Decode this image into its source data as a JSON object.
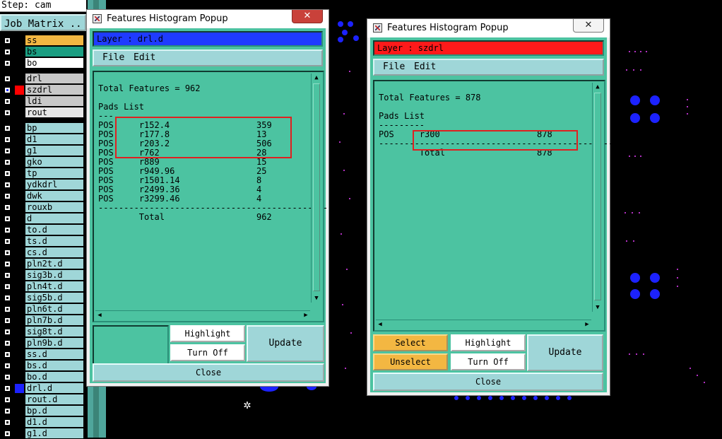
{
  "app": {
    "step_label": "Step: cam",
    "job_matrix_label": "Job Matrix ..",
    "layers": [
      {
        "name": "ss",
        "color": "#f3b742",
        "swatch": "#000"
      },
      {
        "name": "bs",
        "color": "#1b9e82",
        "swatch": "#000"
      },
      {
        "name": "bo",
        "color": "#ffffff",
        "swatch": "#000"
      },
      {
        "name": "drl",
        "color": "#c8c8c8",
        "swatch": "#000"
      },
      {
        "name": "szdrl",
        "color": "#c8c8c8",
        "swatch": "#ff0000",
        "selected": true
      },
      {
        "name": "ldi",
        "color": "#c8c8c8",
        "swatch": "#000"
      },
      {
        "name": "rout",
        "color": "#e6e6e6",
        "swatch": "#000"
      },
      {
        "name": "bp",
        "swatch": "#000"
      },
      {
        "name": "d1",
        "swatch": "#000"
      },
      {
        "name": "g1",
        "swatch": "#000"
      },
      {
        "name": "gko",
        "swatch": "#000"
      },
      {
        "name": "tp",
        "swatch": "#000"
      },
      {
        "name": "ydkdrl",
        "swatch": "#000"
      },
      {
        "name": "dwk",
        "swatch": "#000"
      },
      {
        "name": "rouxb",
        "swatch": "#000"
      },
      {
        "name": "d",
        "swatch": "#000"
      },
      {
        "name": "to.d",
        "swatch": "#000"
      },
      {
        "name": "ts.d",
        "swatch": "#000"
      },
      {
        "name": "cs.d",
        "swatch": "#000"
      },
      {
        "name": "pln2t.d",
        "swatch": "#000"
      },
      {
        "name": "sig3b.d",
        "swatch": "#000"
      },
      {
        "name": "pln4t.d",
        "swatch": "#000"
      },
      {
        "name": "sig5b.d",
        "swatch": "#000"
      },
      {
        "name": "pln6t.d",
        "swatch": "#000"
      },
      {
        "name": "pln7b.d",
        "swatch": "#000"
      },
      {
        "name": "sig8t.d",
        "swatch": "#000"
      },
      {
        "name": "pln9b.d",
        "swatch": "#000"
      },
      {
        "name": "ss.d",
        "swatch": "#000"
      },
      {
        "name": "bs.d",
        "swatch": "#000"
      },
      {
        "name": "bo.d",
        "swatch": "#000"
      },
      {
        "name": "drl.d",
        "swatch": "#1c22ff"
      },
      {
        "name": "rout.d",
        "swatch": "#000"
      },
      {
        "name": "bp.d",
        "swatch": "#000"
      },
      {
        "name": "d1.d",
        "swatch": "#000"
      },
      {
        "name": "g1.d",
        "swatch": "#000"
      }
    ]
  },
  "popup1": {
    "title": "Features Histogram Popup",
    "close_glyph": "✕",
    "layer_label": "Layer :  drl.d",
    "layer_color": "#1f3bff",
    "menu": {
      "file": "File",
      "edit": "Edit"
    },
    "total_line": "Total Features = 962",
    "section": "Pads List",
    "section_rule": "---",
    "rows": [
      {
        "type": "POS",
        "symbol": "r152.4",
        "count": "359"
      },
      {
        "type": "POS",
        "symbol": "r177.8",
        "count": "13"
      },
      {
        "type": "POS",
        "symbol": "r203.2",
        "count": "506"
      },
      {
        "type": "POS",
        "symbol": "r762",
        "count": "28"
      },
      {
        "type": "POS",
        "symbol": "r889",
        "count": "15"
      },
      {
        "type": "POS",
        "symbol": "r949.96",
        "count": "25"
      },
      {
        "type": "POS",
        "symbol": "r1501.14",
        "count": "8"
      },
      {
        "type": "POS",
        "symbol": "r2499.36",
        "count": "4"
      },
      {
        "type": "POS",
        "symbol": "r3299.46",
        "count": "4"
      }
    ],
    "rule": "---------------------------------------------------",
    "total_label": "Total",
    "total_value": "962",
    "buttons": {
      "highlight": "Highlight",
      "turn_off": "Turn Off",
      "update": "Update",
      "close": "Close"
    }
  },
  "popup2": {
    "title": "Features Histogram Popup",
    "close_glyph": "✕",
    "layer_label": "Layer :  szdrl",
    "layer_color": "#ff1a1a",
    "menu": {
      "file": "File",
      "edit": "Edit"
    },
    "total_line": "Total Features = 878",
    "section": "Pads List",
    "section_rule": "---------",
    "rows": [
      {
        "type": "POS",
        "symbol": "r300",
        "count": "878"
      }
    ],
    "rule": "---------------------------------------------------",
    "total_label": "Total",
    "total_value": "878",
    "buttons": {
      "select": "Select",
      "unselect": "Unselect",
      "highlight": "Highlight",
      "turn_off": "Turn Off",
      "update": "Update",
      "close": "Close"
    }
  }
}
